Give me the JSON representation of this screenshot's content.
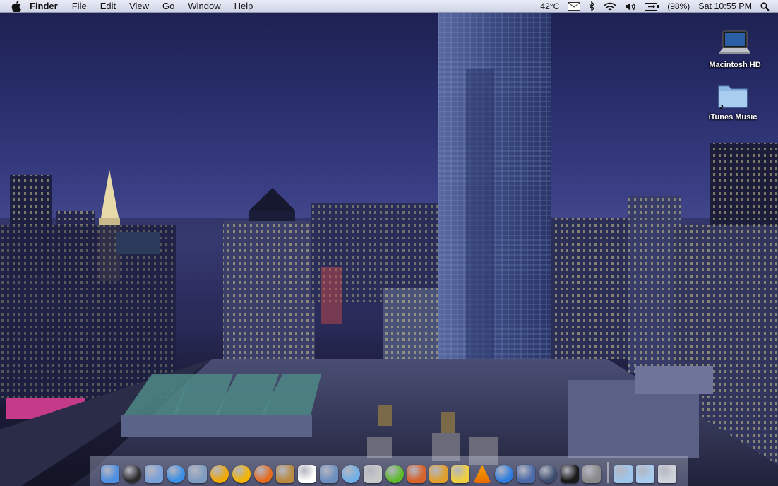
{
  "menubar": {
    "app_name": "Finder",
    "menus": [
      "File",
      "Edit",
      "View",
      "Go",
      "Window",
      "Help"
    ],
    "status": {
      "temperature": "42°C",
      "battery": "(98%)",
      "clock": "Sat 10:55 PM"
    }
  },
  "desktop": {
    "icons": [
      {
        "label": "Macintosh HD",
        "icon": "laptop-drive-icon"
      },
      {
        "label": "iTunes Music",
        "icon": "folder-alias-icon"
      }
    ]
  },
  "dock": {
    "apps": [
      {
        "name": "finder",
        "color": "#4d8fe0"
      },
      {
        "name": "dashboard",
        "color": "#2b2b2b"
      },
      {
        "name": "preview",
        "color": "#7aa0d8"
      },
      {
        "name": "safari",
        "color": "#3a8fe6"
      },
      {
        "name": "ichat",
        "color": "#7f9cc2"
      },
      {
        "name": "aim",
        "color": "#f2a900"
      },
      {
        "name": "adium",
        "color": "#f4b400"
      },
      {
        "name": "firefox",
        "color": "#e66b1f"
      },
      {
        "name": "address-book",
        "color": "#b98a3f"
      },
      {
        "name": "ical",
        "color": "#ffffff"
      },
      {
        "name": "iphoto",
        "color": "#6d8fbf"
      },
      {
        "name": "itunes",
        "color": "#6fb0e8"
      },
      {
        "name": "textedit",
        "color": "#c9c9c9"
      },
      {
        "name": "frontrow",
        "color": "#5dba2c"
      },
      {
        "name": "photo-booth",
        "color": "#d7622a"
      },
      {
        "name": "garageband",
        "color": "#e0a030"
      },
      {
        "name": "imovie",
        "color": "#f0d040"
      },
      {
        "name": "vlc",
        "color": "#f07d00"
      },
      {
        "name": "quicktime",
        "color": "#2d7de0"
      },
      {
        "name": "spaces",
        "color": "#4a6aa8"
      },
      {
        "name": "time-machine",
        "color": "#3b4d6e"
      },
      {
        "name": "activity-monitor",
        "color": "#1a1a1a"
      },
      {
        "name": "system-preferences",
        "color": "#8a8a8a"
      }
    ],
    "folders": [
      {
        "name": "downloads-stack",
        "color": "#9fc6ea"
      },
      {
        "name": "documents-stack",
        "color": "#a9cdee"
      },
      {
        "name": "trash",
        "color": "#cfd3da"
      }
    ]
  }
}
